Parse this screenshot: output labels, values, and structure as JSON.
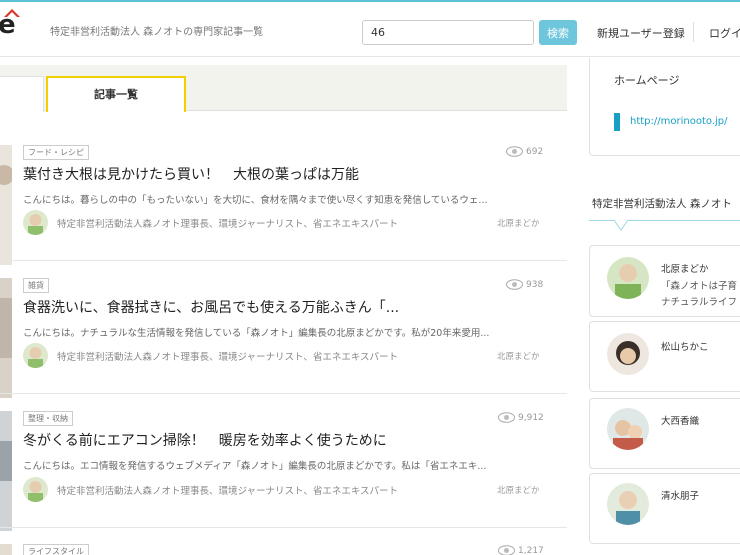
{
  "header": {
    "logo_letter": "e",
    "site_title": "特定非営利活動法人 森ノオトの専門家記事一覧",
    "search_value": "46",
    "search_button": "検索",
    "register": "新規ユーザー登録",
    "login": "ログイ"
  },
  "tabs": {
    "active_label": "記事一覧"
  },
  "articles": [
    {
      "category": "フード・レシピ",
      "views": "692",
      "title": "葉付き大根は見かけたら買い！　大根の葉っぱは万能",
      "excerpt": "こんにちは。暮らしの中の「もったいない」を大切に、食材を隅々まで使い尽くす知恵を発信しているウェ...",
      "author_title": "特定非営利活動法人森ノオト理事長、環境ジャーナリスト、省エネエキスパート",
      "author_name": "北原まどか"
    },
    {
      "category": "雑貨",
      "views": "938",
      "title": "食器洗いに、食器拭きに、お風呂でも使える万能ふきん「...",
      "excerpt": "こんにちは。ナチュラルな生活情報を発信している「森ノオト」編集長の北原まどかです。私が20年来愛用...",
      "author_title": "特定非営利活動法人森ノオト理事長、環境ジャーナリスト、省エネエキスパート",
      "author_name": "北原まどか"
    },
    {
      "category": "整理・収納",
      "views": "9,912",
      "title": "冬がくる前にエアコン掃除！　暖房を効率よく使うために",
      "excerpt": "こんにちは。エコ情報を発信するウェブメディア「森ノオト」編集長の北原まどかです。私は「省エネエキ...",
      "author_title": "特定非営利活動法人森ノオト理事長、環境ジャーナリスト、省エネエキスパート",
      "author_name": "北原まどか"
    },
    {
      "category": "ライフスタイル",
      "views": "1,217"
    }
  ],
  "sidebar": {
    "homepage_label": "ホームページ",
    "homepage_url": "http://morinooto.jp/",
    "section_title": "特定非営利活動法人 森ノオト",
    "members": [
      {
        "name": "北原まどか",
        "line1": "「森ノオトは子育",
        "line2": "ナチュラルライフ"
      },
      {
        "name": "松山ちかこ"
      },
      {
        "name": "大西香織"
      },
      {
        "name": "清水朋子"
      }
    ]
  },
  "colors": {
    "accent": "#5bc0d8",
    "tab_highlight": "#f0d000",
    "link": "#17a0c4",
    "search_button": "#6ec6dc"
  }
}
